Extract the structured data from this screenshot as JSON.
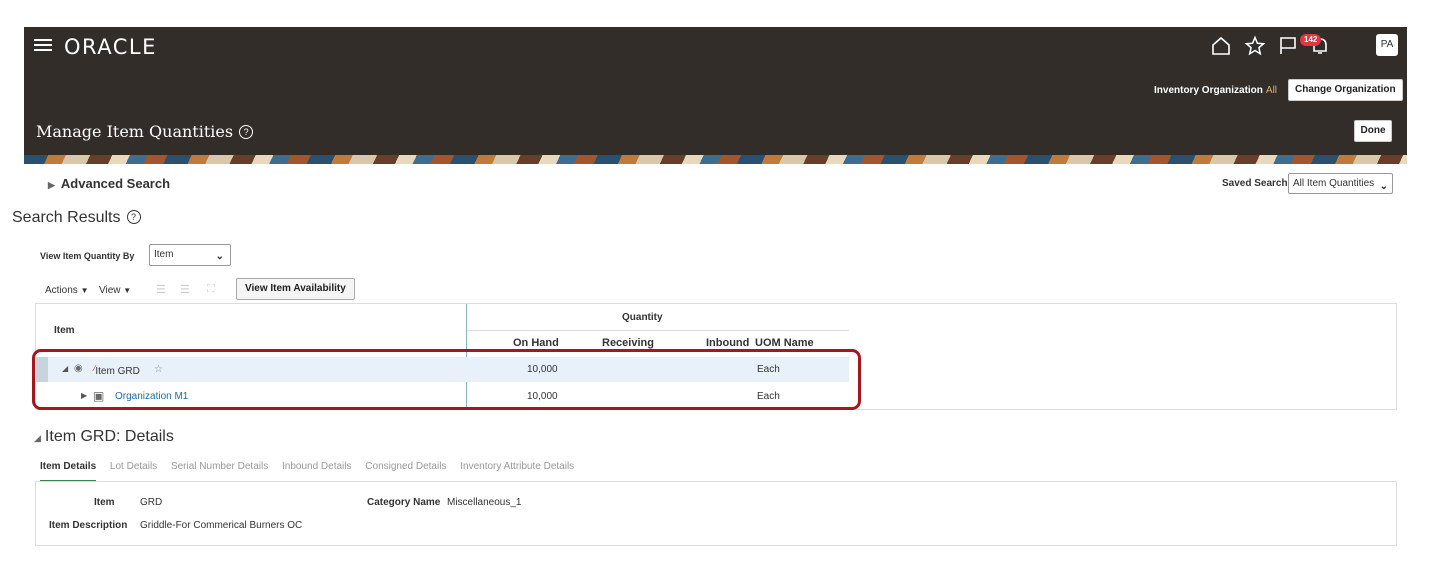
{
  "header": {
    "logo": "ORACLE",
    "notification_count": "142",
    "avatar_initials": "PA",
    "inventory_org_label": "Inventory Organization",
    "inventory_org_value": "All",
    "change_org_label": "Change Organization",
    "page_title": "Manage Item Quantities",
    "done_label": "Done"
  },
  "search": {
    "advanced_label": "Advanced Search",
    "saved_search_label": "Saved Search",
    "saved_search_value": "All Item Quantities"
  },
  "results": {
    "title": "Search Results",
    "view_by_label": "View Item Quantity By",
    "view_by_value": "Item",
    "actions_label": "Actions",
    "view_label": "View",
    "view_availability_label": "View Item Availability"
  },
  "table": {
    "col_item": "Item",
    "group_quantity": "Quantity",
    "col_on_hand": "On Hand",
    "col_receiving": "Receiving",
    "col_inbound": "Inbound",
    "col_uom": "UOM Name",
    "rows": [
      {
        "item": "Item GRD",
        "on_hand": "10,000",
        "receiving": "",
        "inbound": "",
        "uom": "Each"
      },
      {
        "item": "Organization M1",
        "on_hand": "10,000",
        "receiving": "",
        "inbound": "",
        "uom": "Each"
      }
    ]
  },
  "details": {
    "title": "Item GRD: Details",
    "tabs": [
      "Item Details",
      "Lot Details",
      "Serial Number Details",
      "Inbound Details",
      "Consigned Details",
      "Inventory Attribute Details"
    ],
    "item_label": "Item",
    "item_value": "GRD",
    "category_label": "Category Name",
    "category_value": "Miscellaneous_1",
    "description_label": "Item Description",
    "description_value": "Griddle-For Commerical Burners OC"
  },
  "colors": {
    "header_bg": "#322d29",
    "link": "#1a6ea0",
    "highlight": "#a4171d",
    "badge": "#e0383e"
  }
}
